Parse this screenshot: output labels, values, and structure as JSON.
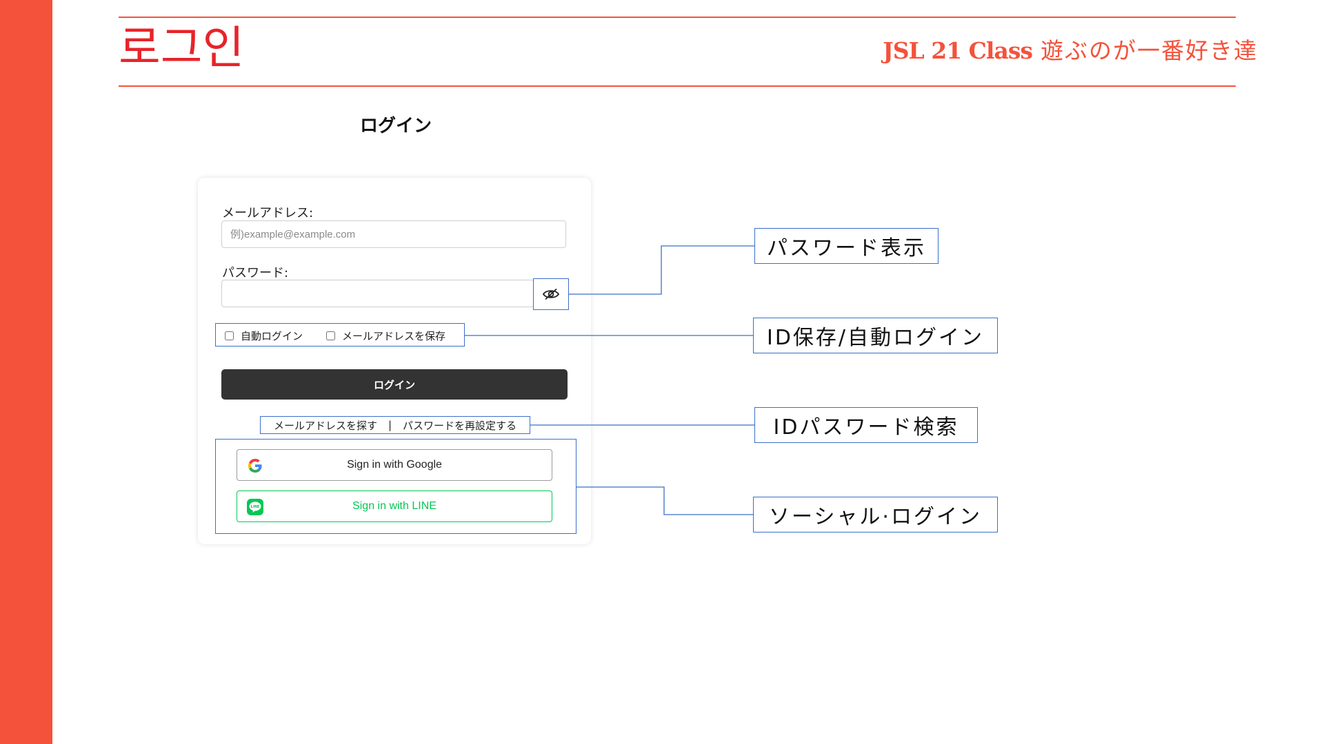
{
  "slide": {
    "title": "로그인",
    "brand_bold": "JSL 21 Class",
    "brand_tagline": "遊ぶのが一番好き達"
  },
  "login": {
    "heading": "ログイン",
    "email_label": "メールアドレス:",
    "email_placeholder": "例)example@example.com",
    "password_label": "パスワード:",
    "auto_login_label": "自動ログイン",
    "save_email_label": "メールアドレスを保存",
    "submit_label": "ログイン",
    "find_email_link": "メールアドレスを探す",
    "link_separator": "|",
    "reset_password_link": "パスワードを再設定する",
    "google_button": "Sign in with Google",
    "line_button": "Sign in with LINE",
    "line_icon_text": "LINE"
  },
  "callouts": {
    "show_password": "パスワード表示",
    "id_save_auto_login": "ID保存/自動ログイン",
    "id_password_search": "IDパスワード検索",
    "social_login": "ソーシャル·ログイン"
  },
  "colors": {
    "accent": "#f4523b",
    "title": "#e8232a",
    "annotation_line": "#3b6fc9",
    "login_button": "#333333",
    "line_green": "#06c755"
  },
  "icons": {
    "password_toggle": "eye-slash-icon",
    "google": "google-logo-icon",
    "line": "line-logo-icon"
  }
}
